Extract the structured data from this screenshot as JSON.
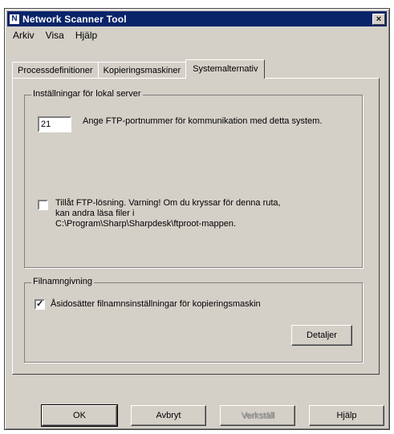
{
  "window": {
    "title": "Network Scanner Tool",
    "close_glyph": "×"
  },
  "menu": {
    "items": [
      "Arkiv",
      "Visa",
      "Hjälp"
    ]
  },
  "tabs": [
    {
      "label": "Processdefinitioner",
      "active": false
    },
    {
      "label": "Kopieringsmaskiner",
      "active": false
    },
    {
      "label": "Systemalternativ",
      "active": true
    }
  ],
  "local_server": {
    "group_title": "Inställningar för lokal server",
    "port_value": "21",
    "port_description": "Ange FTP-portnummer för kommunikation med detta system.",
    "ftp_checkbox_checked": false,
    "ftp_checkbox_label_1": "Tillåt FTP-lösning. Varning! Om du kryssar för denna ruta,",
    "ftp_checkbox_label_2": "kan andra läsa filer i",
    "ftp_checkbox_label_3": "C:\\Program\\Sharp\\Sharpdesk\\ftproot-mappen."
  },
  "naming": {
    "group_title": "Filnamngivning",
    "override_checked": true,
    "override_label": "Åsidosätter filnamnsinställningar för kopieringsmaskin",
    "details_button": "Detaljer"
  },
  "buttons": {
    "ok": "OK",
    "cancel": "Avbryt",
    "apply": "Verkställ",
    "help": "Hjälp"
  },
  "icons": {
    "app": "network-scanner-app-icon",
    "close": "close-icon",
    "check": "checkmark-icon"
  }
}
